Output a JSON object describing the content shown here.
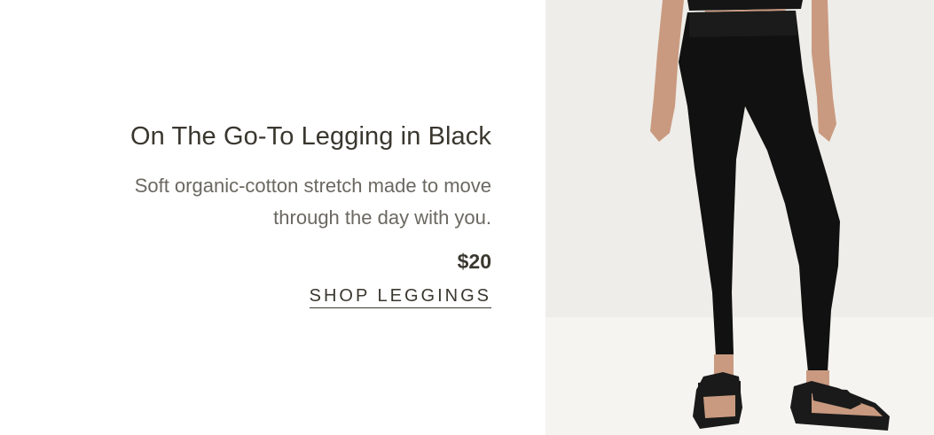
{
  "product": {
    "title": "On The Go-To Legging in Black",
    "description_line1": "Soft organic-cotton stretch made to move",
    "description_line2": "through the day with you.",
    "price": "$20",
    "cta_label": "SHOP LEGGINGS"
  },
  "image": {
    "subject": "model-wearing-black-leggings-and-sandals"
  },
  "colors": {
    "text_primary": "#3a372f",
    "text_secondary": "#6b6861",
    "photo_background": "#eeede9"
  }
}
